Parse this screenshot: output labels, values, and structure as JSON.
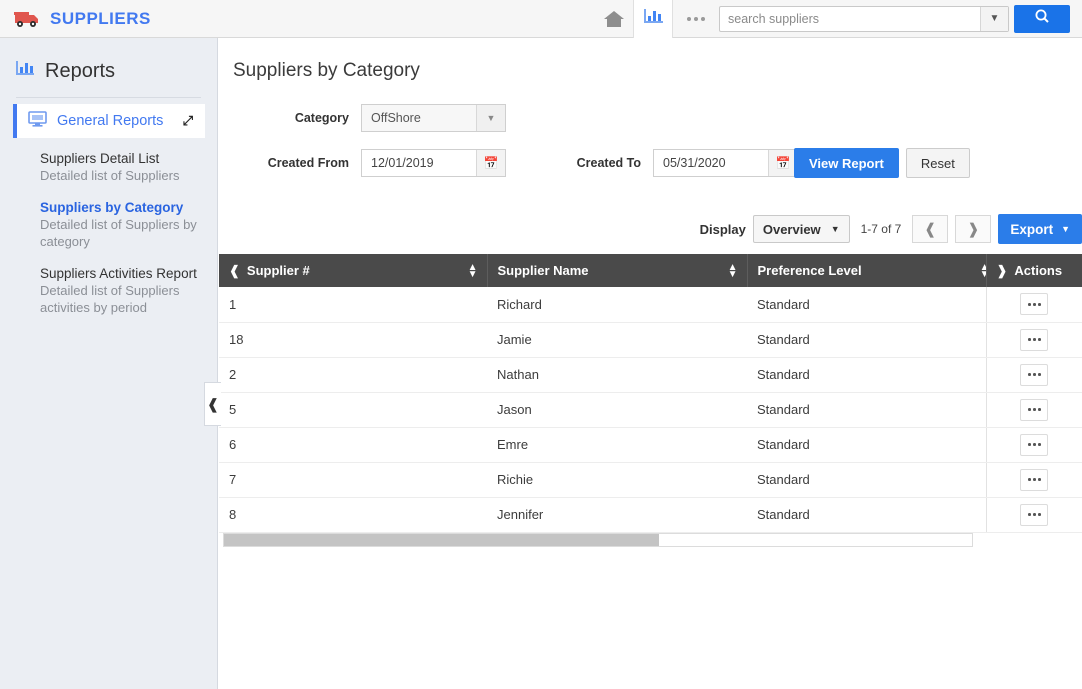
{
  "topbar": {
    "brand": "SUPPLIERS",
    "logo_icon": "truck-icon",
    "home_icon": "home-icon",
    "reports_icon": "bar-chart-icon",
    "more_icon": "ellipsis-icon",
    "search_placeholder": "search suppliers",
    "search_value": "",
    "search_caret_icon": "chevron-down-icon",
    "search_button_icon": "magnifier-icon"
  },
  "sidebar": {
    "icon": "bar-chart-icon",
    "title": "Reports",
    "group": {
      "icon": "monitor-icon",
      "label": "General Reports",
      "chevron": "chevron-down-icon"
    },
    "reports": [
      {
        "name": "Suppliers Detail List",
        "desc": "Detailed list of Suppliers",
        "active": false
      },
      {
        "name": "Suppliers by Category",
        "desc": "Detailed list of Suppliers by category",
        "active": true
      },
      {
        "name": "Suppliers Activities Report",
        "desc": "Detailed list of Suppliers activities by period",
        "active": false
      }
    ],
    "collapse_icon": "chevron-left-icon"
  },
  "main": {
    "page_title": "Suppliers by Category",
    "filters": {
      "category_label": "Category",
      "category_value": "OffShore",
      "category_caret_icon": "caret-down-icon",
      "created_from_label": "Created From",
      "created_from_value": "12/01/2019",
      "created_to_label": "Created To",
      "created_to_value": "05/31/2020",
      "calendar_icon": "calendar-icon",
      "view_report_label": "View Report",
      "reset_label": "Reset"
    },
    "toolbar": {
      "display_label": "Display",
      "display_value": "Overview",
      "display_caret_icon": "caret-down-icon",
      "page_info": "1-7 of 7",
      "prev_icon": "chevron-left-icon",
      "next_icon": "chevron-right-icon",
      "export_label": "Export",
      "export_caret_icon": "caret-down-icon"
    },
    "table": {
      "columns": [
        {
          "label": "Supplier #",
          "sortable": true,
          "lead_chevron": "chevron-left-icon"
        },
        {
          "label": "Supplier Name",
          "sortable": true,
          "lead_chevron": ""
        },
        {
          "label": "Preference Level",
          "sortable": true,
          "lead_chevron": ""
        },
        {
          "label": "Actions",
          "sortable": false,
          "lead_chevron": "chevron-right-icon"
        }
      ],
      "rows": [
        {
          "supplier_no": "1",
          "supplier_name": "Richard",
          "preference_level": "Standard"
        },
        {
          "supplier_no": "18",
          "supplier_name": "Jamie",
          "preference_level": "Standard"
        },
        {
          "supplier_no": "2",
          "supplier_name": "Nathan",
          "preference_level": "Standard"
        },
        {
          "supplier_no": "5",
          "supplier_name": "Jason",
          "preference_level": "Standard"
        },
        {
          "supplier_no": "6",
          "supplier_name": "Emre",
          "preference_level": "Standard"
        },
        {
          "supplier_no": "7",
          "supplier_name": "Richie",
          "preference_level": "Standard"
        },
        {
          "supplier_no": "8",
          "supplier_name": "Jennifer",
          "preference_level": "Standard"
        }
      ],
      "row_action_icon": "kebab-menu-icon"
    }
  },
  "colors": {
    "brand_blue": "#4279f0",
    "accent_blue": "#2b7de9",
    "link_blue": "#2a64e0",
    "logo_red": "#e0564e",
    "table_header": "#4a4a4a",
    "sidebar_bg": "#ebeef3"
  }
}
